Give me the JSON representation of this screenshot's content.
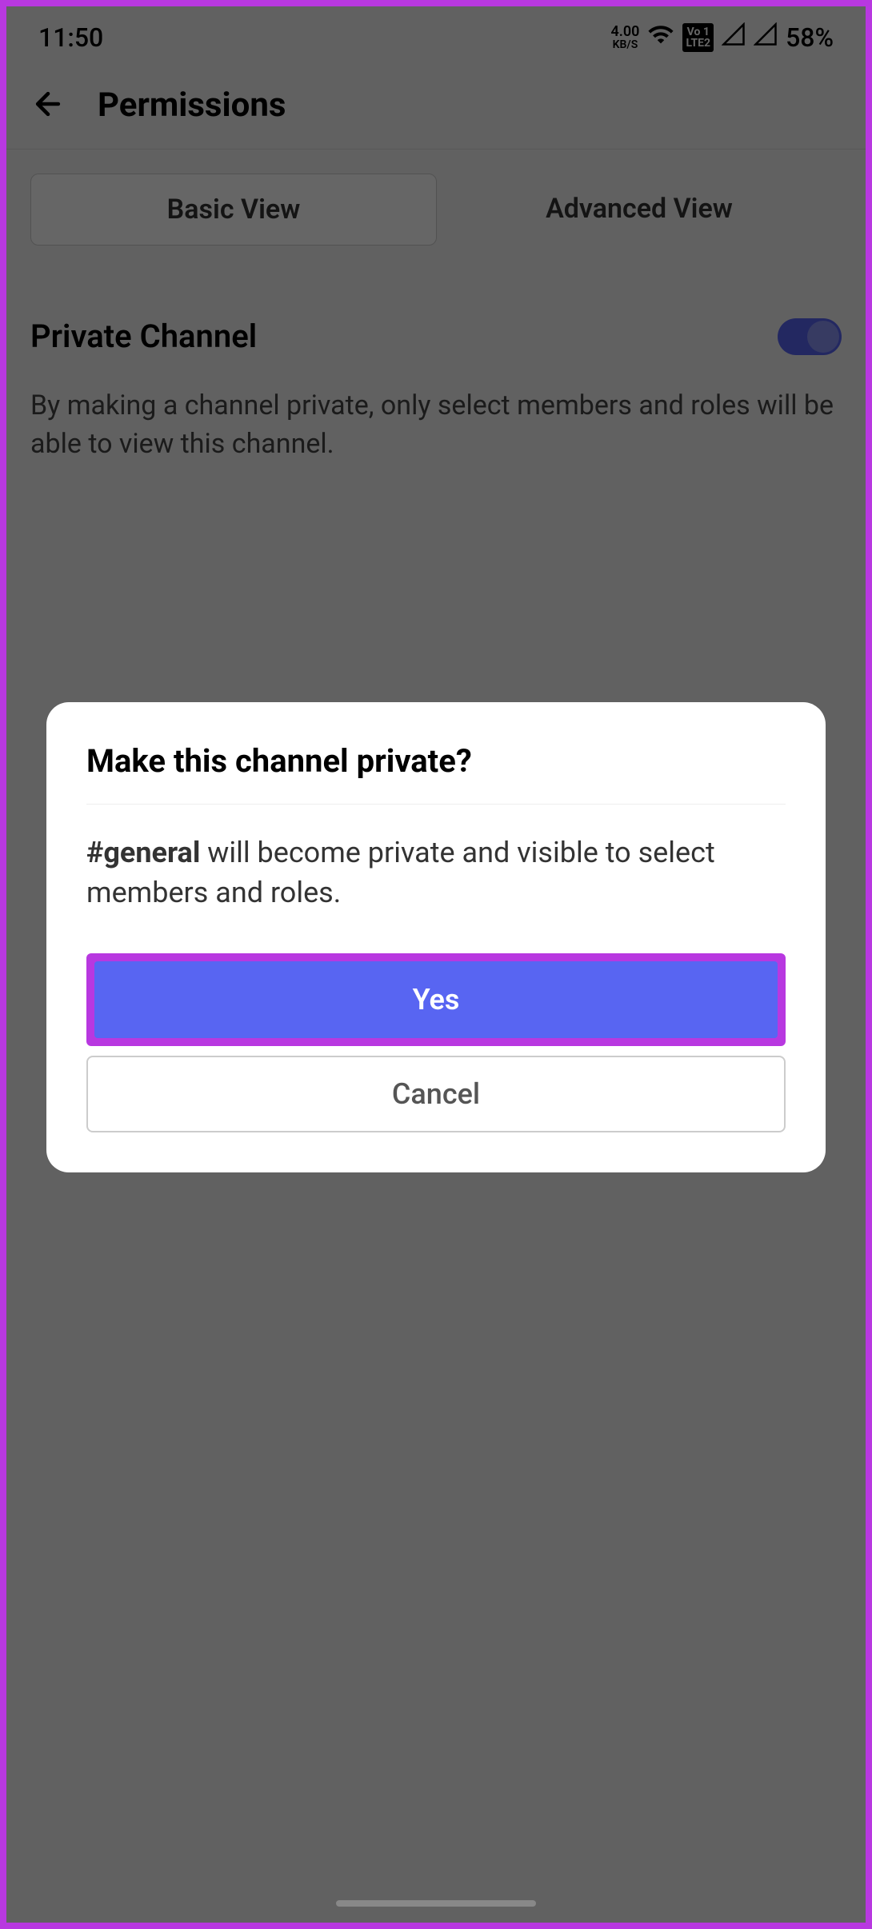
{
  "status_bar": {
    "time": "11:50",
    "data_rate": "4.00",
    "data_unit": "KB/S",
    "lte_badge_top": "Vo 1",
    "lte_badge_bottom": "LTE2",
    "battery": "58%"
  },
  "header": {
    "title": "Permissions"
  },
  "tabs": {
    "basic": "Basic View",
    "advanced": "Advanced View"
  },
  "setting": {
    "label": "Private Channel",
    "description": "By making a channel private, only select members and roles will be able to view this channel."
  },
  "dialog": {
    "title": "Make this channel private?",
    "channel_name": "#general",
    "body_rest": " will become private and visible to select members and roles.",
    "yes": "Yes",
    "cancel": "Cancel"
  }
}
